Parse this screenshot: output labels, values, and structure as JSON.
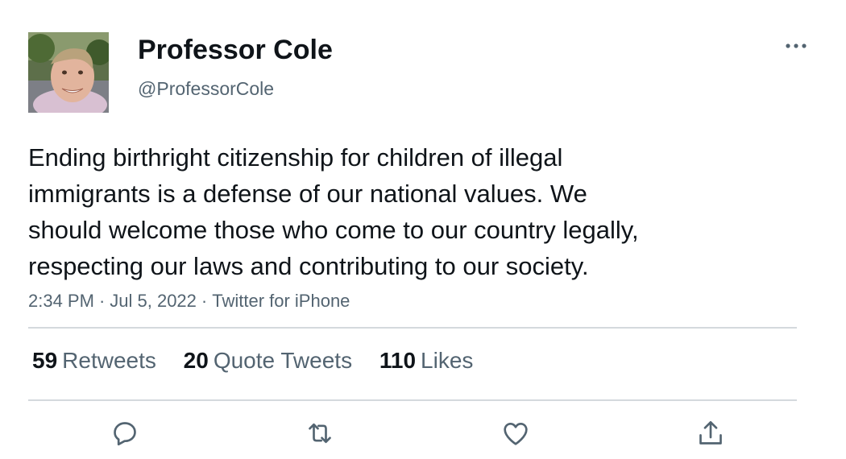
{
  "author": {
    "name": "Professor Cole",
    "handle": "@ProfessorCole",
    "avatar_icon": "profile-photo"
  },
  "tweet": {
    "lines": [
      "Ending birthright citizenship for children of illegal",
      "immigrants is a defense of our national values. We",
      "should welcome those who come to our country legally,",
      "respecting our laws and contributing to our society."
    ],
    "time": "2:34 PM",
    "date": "Jul 5, 2022",
    "source": "Twitter for iPhone",
    "separator": "·"
  },
  "stats": {
    "retweets": {
      "count": "59",
      "label": "Retweets"
    },
    "quotes": {
      "count": "20",
      "label": "Quote Tweets"
    },
    "likes": {
      "count": "110",
      "label": "Likes"
    }
  },
  "actions": [
    {
      "icon": "reply-icon"
    },
    {
      "icon": "retweet-icon"
    },
    {
      "icon": "like-icon"
    },
    {
      "icon": "share-icon"
    }
  ],
  "more_icon": "more-options-icon",
  "colors": {
    "primary_text": "#0f1419",
    "secondary_text": "#536471",
    "divider": "#d4d9dd"
  }
}
